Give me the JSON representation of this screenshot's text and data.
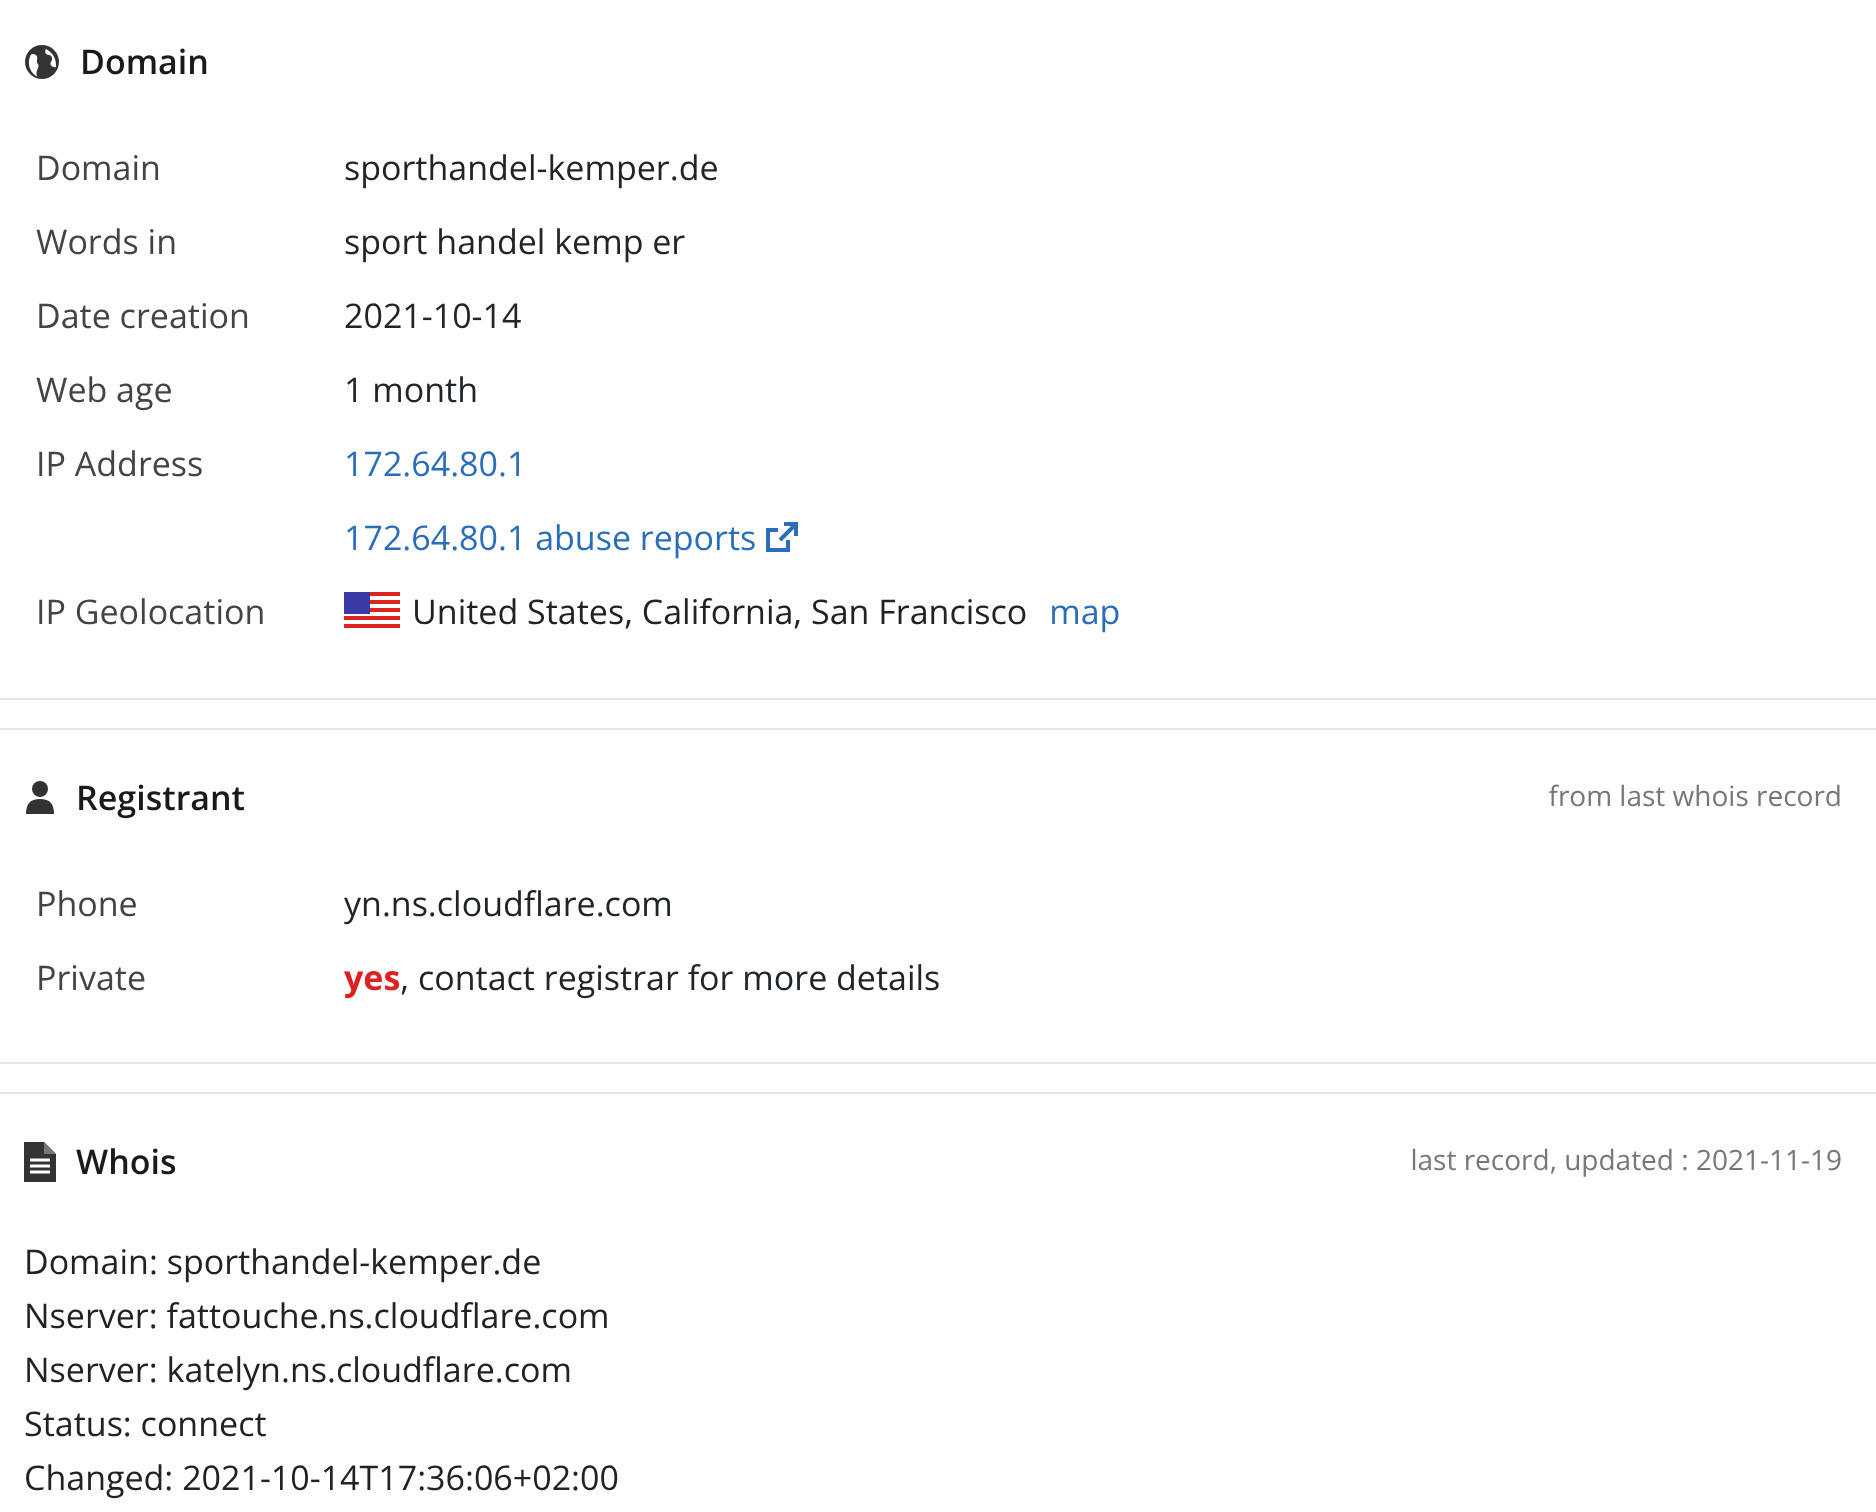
{
  "sections": [
    {
      "kind": "domain",
      "title": "Domain",
      "rows": [
        {
          "kind": "text",
          "label": "Domain",
          "value": "sporthandel-kemper.de"
        },
        {
          "kind": "text",
          "label": "Words in",
          "value": "sport handel kemp er"
        },
        {
          "kind": "text",
          "label": "Date creation",
          "value": "2021-10-14"
        },
        {
          "kind": "text",
          "label": "Web age",
          "value": "1 month"
        },
        {
          "kind": "link",
          "label": "IP Address",
          "value": "172.64.80.1"
        },
        {
          "kind": "external",
          "value": "172.64.80.1 abuse reports"
        },
        {
          "kind": "geo",
          "label": "IP Geolocation",
          "value": "United States, California, San Francisco",
          "link": "map"
        }
      ]
    },
    {
      "kind": "registrant",
      "title": "Registrant",
      "note": "from last whois record",
      "rows": [
        {
          "kind": "text",
          "label": "Phone",
          "value": "yn.ns.cloudflare.com"
        },
        {
          "kind": "text",
          "label": "Private",
          "value": "**yes**, contact registrar for more details"
        }
      ]
    },
    {
      "kind": "whois",
      "title": "Whois",
      "note": "last record, updated : 2021-11-19",
      "lines": [
        "Domain: sporthandel-kemper.de",
        "Nserver: fattouche.ns.cloudflare.com",
        "Nserver: katelyn.ns.cloudflare.com",
        "Status: connect",
        "Changed: 2021-10-14T17:36:06+02:00"
      ]
    }
  ]
}
